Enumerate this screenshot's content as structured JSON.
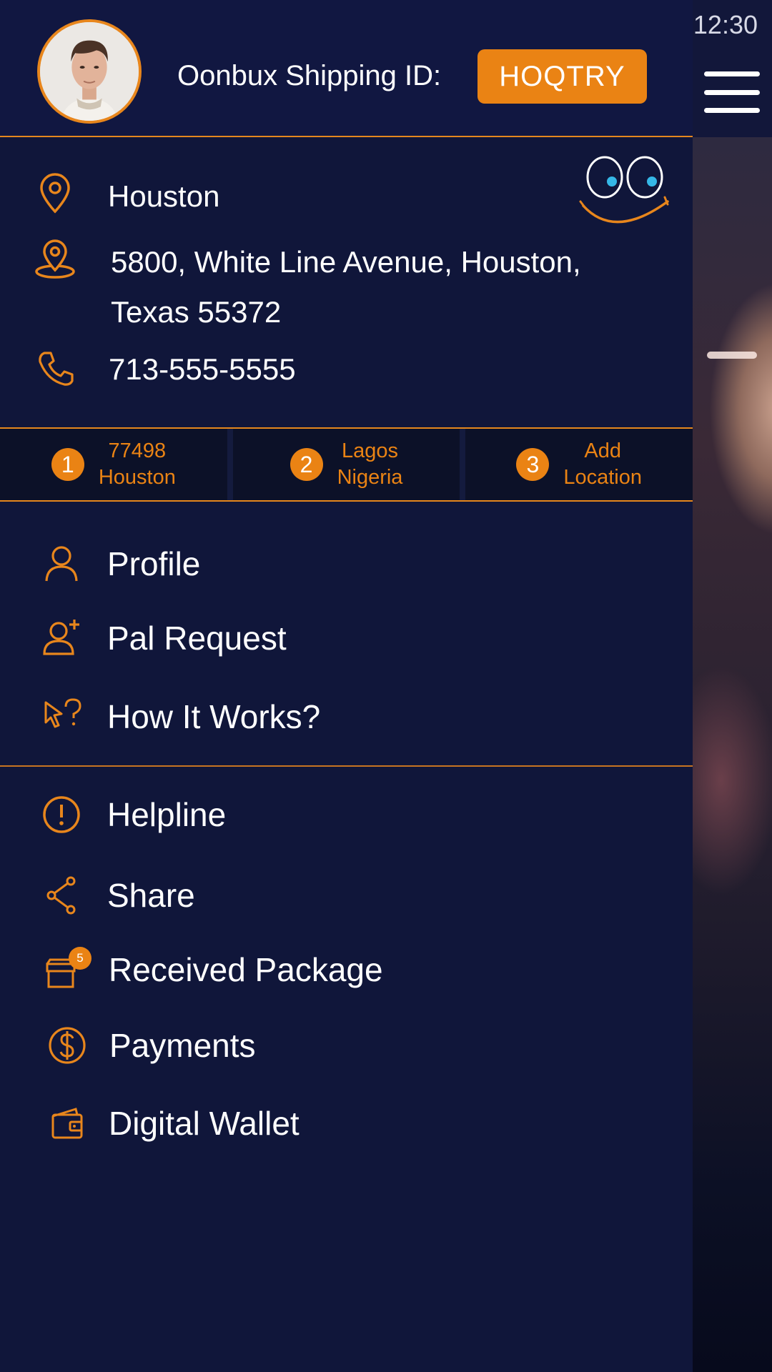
{
  "status_bar": {
    "time": "12:30"
  },
  "header": {
    "shipping_label": "Oonbux Shipping ID:",
    "shipping_id": "HOQTRY"
  },
  "info": {
    "city": "Houston",
    "address_line1": "5800, White Line Avenue, Houston,",
    "address_line2": "Texas 55372",
    "phone": "713-555-5555"
  },
  "locations": [
    {
      "number": "1",
      "line1": "77498",
      "line2": "Houston"
    },
    {
      "number": "2",
      "line1": "Lagos",
      "line2": "Nigeria"
    },
    {
      "number": "3",
      "line1": "Add",
      "line2": "Location"
    }
  ],
  "menu": {
    "profile": "Profile",
    "pal_request": "Pal Request",
    "how_it_works": "How It Works?",
    "helpline": "Helpline",
    "share": "Share",
    "received_package": "Received Package",
    "received_package_badge": "5",
    "payments": "Payments",
    "digital_wallet": "Digital Wallet"
  },
  "icons": {
    "location": "location-pin-icon",
    "address": "map-pin-icon",
    "phone": "phone-icon",
    "profile": "user-icon",
    "pal_request": "add-user-icon",
    "how_it_works": "cursor-question-icon",
    "helpline": "alert-circle-icon",
    "share": "share-icon",
    "received_package": "package-icon",
    "payments": "dollar-circle-icon",
    "digital_wallet": "wallet-icon",
    "menu": "hamburger-menu-icon"
  },
  "colors": {
    "accent": "#ea8314",
    "background": "#10163a",
    "text": "#ffffff"
  }
}
